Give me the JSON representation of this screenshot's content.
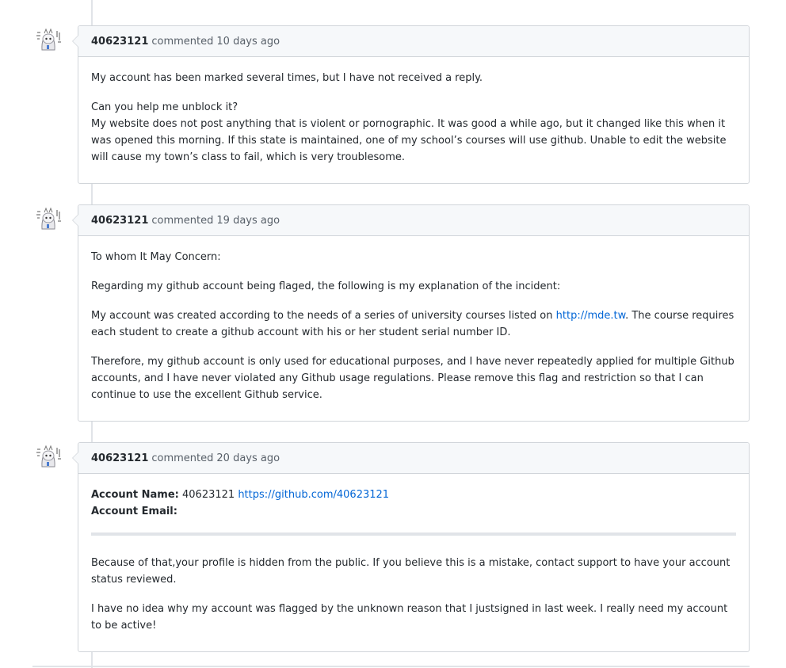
{
  "comments": [
    {
      "author": "40623121",
      "verb": "commented",
      "time": "10 days ago",
      "p1": "My account has been marked several times, but I have not received a reply.",
      "p2_line1": "Can you help me unblock it?",
      "p2_line2": "My website does not post anything that is violent or pornographic. It was good a while ago, but it changed like this when it was opened this morning. If this state is maintained, one of my school’s courses will use github. Unable to edit the website will cause my town’s class to fail, which is very troublesome."
    },
    {
      "author": "40623121",
      "verb": "commented",
      "time": "19 days ago",
      "p1": "To whom It May Concern:",
      "p2": "Regarding my github account being flaged, the following is my explanation of the incident:",
      "p3_before": "My account was created according to the needs of a series of university courses listed on ",
      "p3_link": "http://mde.tw",
      "p3_after": ". The course requires each student to create a github account with his or her student serial number ID.",
      "p4": "Therefore, my github account is only used for educational purposes, and I have never repeatedly applied for multiple Github accounts, and I have never violated any Github usage regulations. Please remove this flag and restriction so that I can continue to use the excellent Github service."
    },
    {
      "author": "40623121",
      "verb": "commented",
      "time": "20 days ago",
      "name_label": "Account Name:",
      "name_value": " 40623121 ",
      "name_link": "https://github.com/40623121",
      "email_label": "Account Email:",
      "p2": "Because of that,your profile is hidden from the public. If you believe this is a mistake, contact support to have your account status reviewed.",
      "p3": "I have no idea why my account was flagged by the unknown reason that I justsigned in last week. I really need my account to be active!"
    }
  ]
}
